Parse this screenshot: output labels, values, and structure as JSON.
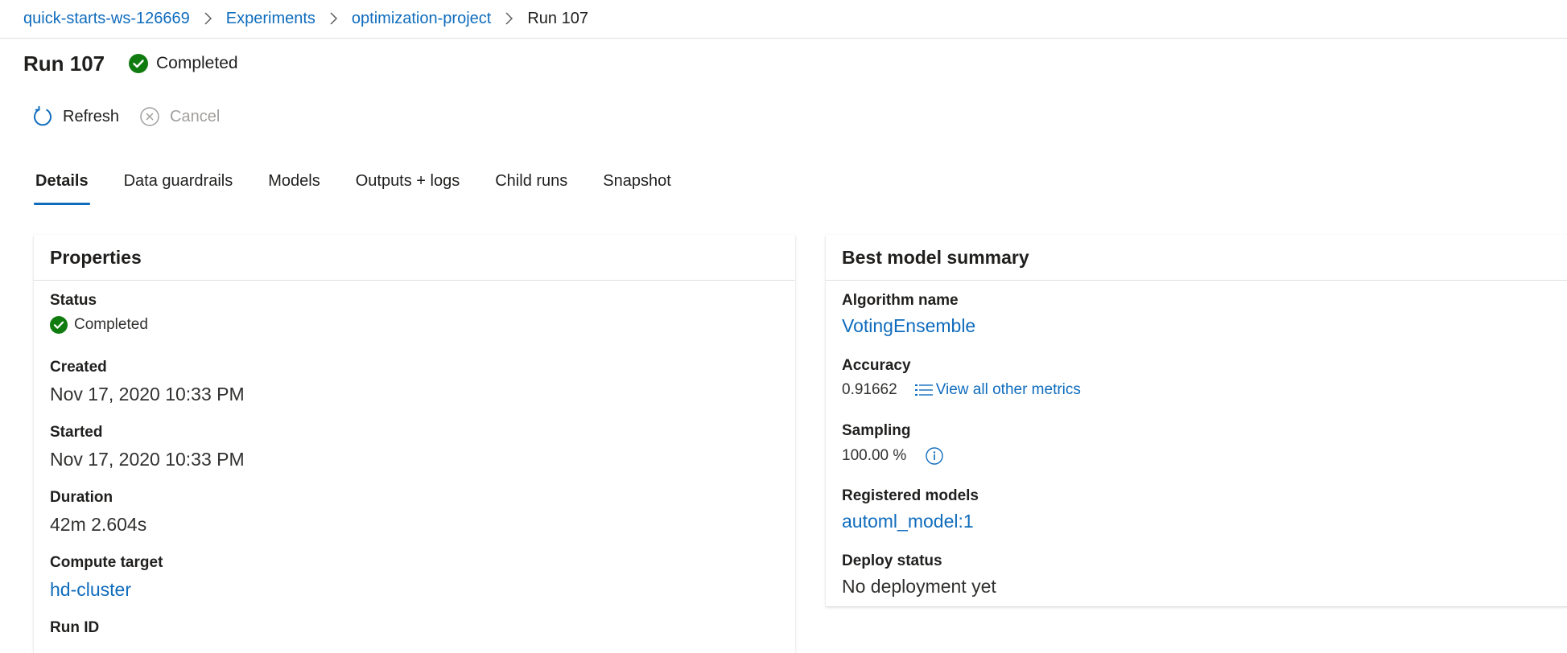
{
  "breadcrumb": {
    "items": [
      {
        "label": "quick-starts-ws-126669"
      },
      {
        "label": "Experiments"
      },
      {
        "label": "optimization-project"
      },
      {
        "label": "Run 107"
      }
    ]
  },
  "header": {
    "title": "Run 107",
    "status": "Completed"
  },
  "toolbar": {
    "refresh_label": "Refresh",
    "cancel_label": "Cancel"
  },
  "tabs": [
    {
      "label": "Details",
      "active": true
    },
    {
      "label": "Data guardrails"
    },
    {
      "label": "Models"
    },
    {
      "label": "Outputs + logs"
    },
    {
      "label": "Child runs"
    },
    {
      "label": "Snapshot"
    }
  ],
  "properties": {
    "title": "Properties",
    "status_label": "Status",
    "status_value": "Completed",
    "created_label": "Created",
    "created_value": "Nov 17, 2020 10:33 PM",
    "started_label": "Started",
    "started_value": "Nov 17, 2020 10:33 PM",
    "duration_label": "Duration",
    "duration_value": "42m 2.604s",
    "compute_label": "Compute target",
    "compute_value": "hd-cluster",
    "runid_label": "Run ID"
  },
  "best_model": {
    "title": "Best model summary",
    "algorithm_label": "Algorithm name",
    "algorithm_value": "VotingEnsemble",
    "accuracy_label": "Accuracy",
    "accuracy_value": "0.91662",
    "view_metrics_label": "View all other metrics",
    "sampling_label": "Sampling",
    "sampling_value": "100.00 %",
    "registered_label": "Registered models",
    "registered_value": "automl_model:1",
    "deploy_label": "Deploy status",
    "deploy_value": "No deployment yet"
  },
  "colors": {
    "accent": "#0f6cbd",
    "success": "#107c10",
    "text": "#201f1e",
    "disabled": "#a19f9d"
  },
  "icons": {
    "breadcrumb_separator": "chevron-right-icon",
    "status": "check-circle-icon",
    "refresh": "refresh-icon",
    "cancel": "cancel-circle-icon",
    "metrics": "list-icon",
    "info": "info-icon"
  }
}
